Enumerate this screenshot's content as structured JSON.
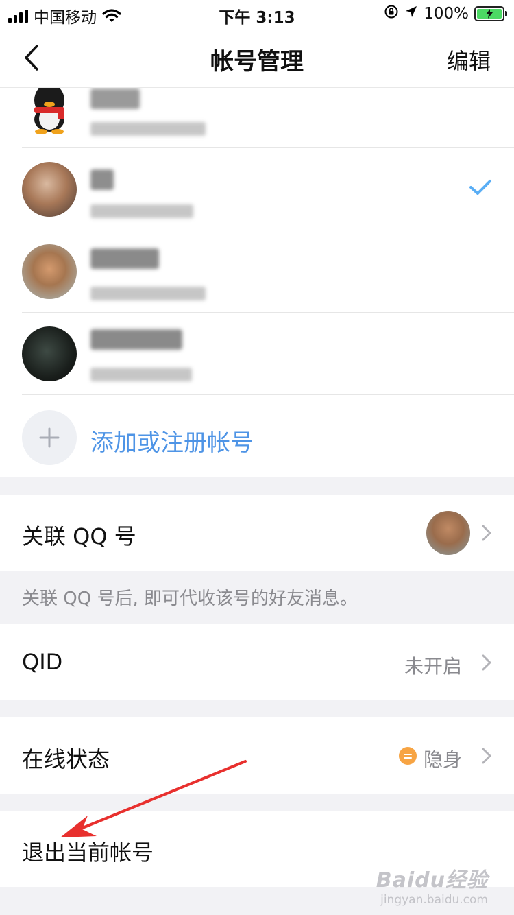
{
  "status_bar": {
    "carrier": "中国移动",
    "time": "下午 3:13",
    "battery_percent": "100%"
  },
  "nav": {
    "title": "帐号管理",
    "edit_label": "编辑"
  },
  "accounts": {
    "add_label": "添加或注册帐号",
    "selected_index": 1
  },
  "linked_qq": {
    "label": "关联 QQ 号",
    "hint": "关联 QQ 号后, 即可代收该号的好友消息。"
  },
  "qid": {
    "label": "QID",
    "value": "未开启"
  },
  "online_status": {
    "label": "在线状态",
    "value": "隐身"
  },
  "logout": {
    "label": "退出当前帐号"
  },
  "watermark": {
    "main": "Baidu经验",
    "sub": "jingyan.baidu.com"
  },
  "colors": {
    "accent_blue": "#4e94e6",
    "check_blue": "#5aaef5",
    "status_orange": "#f7a443",
    "arrow_red": "#e8302e"
  }
}
